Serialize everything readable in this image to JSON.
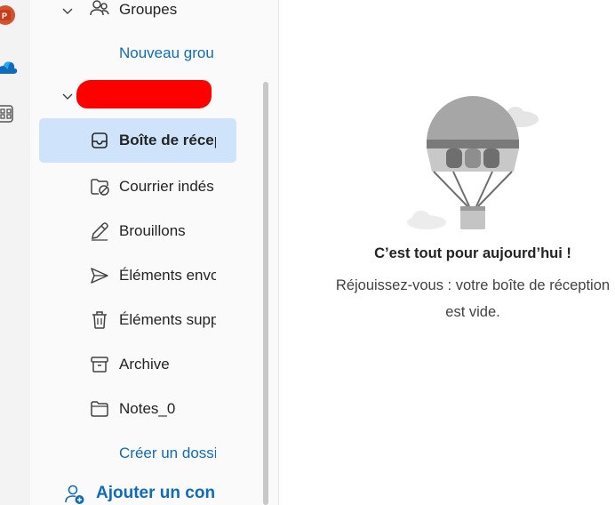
{
  "app_rail": {
    "icons": [
      "powerpoint-icon",
      "onedrive-icon",
      "more-apps-icon"
    ]
  },
  "folders": {
    "groups_header": "Groupes",
    "new_group_link": "Nouveau grou",
    "account_name_redacted": "",
    "items": [
      {
        "label": "Boîte de récep",
        "icon": "inbox-icon",
        "selected": true
      },
      {
        "label": "Courrier indés",
        "icon": "junk-folder-icon"
      },
      {
        "label": "Brouillons",
        "icon": "drafts-pen-icon"
      },
      {
        "label": "Éléments envo",
        "icon": "sent-icon"
      },
      {
        "label": "Éléments supp",
        "icon": "trash-icon"
      },
      {
        "label": "Archive",
        "icon": "archive-icon"
      },
      {
        "label": "Notes_0",
        "icon": "folder-icon"
      }
    ],
    "create_folder_link": "Créer un dossi",
    "add_account": "Ajouter un con"
  },
  "empty_state": {
    "title": "C’est tout pour aujourd’hui !",
    "subtitle_line1": "Réjouissez-vous : votre boîte de réception",
    "subtitle_line2": "est vide."
  },
  "colors": {
    "accent": "#0f6cbd",
    "selected_bg": "#cfe4fa",
    "redaction": "#ff0000"
  }
}
